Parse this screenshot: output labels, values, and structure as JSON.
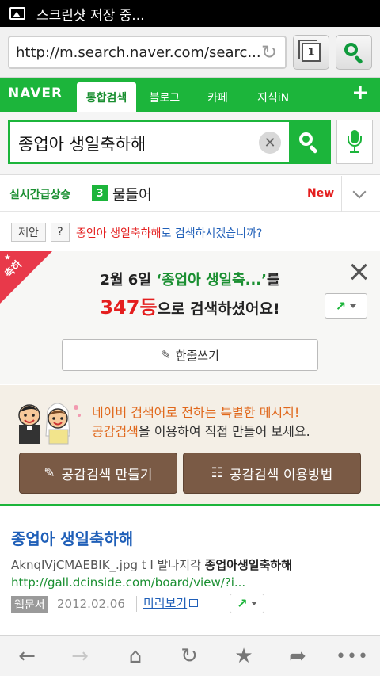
{
  "status_bar": {
    "notification": "스크린샷 저장 중..."
  },
  "browser": {
    "url": "http://m.search.naver.com/searc...",
    "tab_count": "1"
  },
  "nav": {
    "logo": "NAVER",
    "tabs": [
      {
        "label": "통합검색",
        "active": true
      },
      {
        "label": "블로그",
        "active": false
      },
      {
        "label": "카페",
        "active": false
      },
      {
        "label": "지식iN",
        "active": false
      }
    ],
    "more": "+"
  },
  "search": {
    "query": "종업아 생일축하해"
  },
  "trending": {
    "label": "실시간급상승",
    "rank": "3",
    "word": "물들어",
    "badge": "New"
  },
  "suggestion": {
    "tag_label": "제안",
    "help": "?",
    "suggested_query": "종인아 생일축하해",
    "suffix": "로 검색하시겠습니까?"
  },
  "celebration": {
    "ribbon": "축하",
    "date": "2월 6일",
    "query": "‘종업아 생일축...’",
    "line1_suffix": "를",
    "rank": "347등",
    "line2_suffix": "으로 검색하셨어요!",
    "write_button": "한줄쓰기"
  },
  "empathy": {
    "line1": "네이버 검색어로 전하는 특별한 메시지!",
    "line2_highlight": "공감검색",
    "line2_rest": "을 이용하여 직접 만들어 보세요.",
    "make_button": "공감검색 만들기",
    "howto_button": "공감검색 이용방법"
  },
  "result": {
    "title": "종업아 생일축하해",
    "snippet_plain": "AknqIVjCMAEBIK_.jpg t I 발나지각 ",
    "snippet_bold": "종업아생일축하해",
    "url": "http://gall.dcinside.com/board/view/?i...",
    "type": "웹문서",
    "date": "2012.02.06",
    "preview": "미리보기"
  },
  "colors": {
    "naver_green": "#1cb53b",
    "link_blue": "#1f5fb8",
    "alert_red": "#e41e1e",
    "empathy_orange": "#e0681c",
    "empathy_button": "#7a5a45"
  },
  "icons": {
    "status": "image-icon",
    "reload": "reload-icon",
    "search": "search-icon",
    "clear": "clear-icon",
    "voice": "microphone-icon",
    "close": "close-icon",
    "share": "share-icon",
    "pencil": "pencil-icon",
    "bottom": [
      "back-icon",
      "forward-icon",
      "home-icon",
      "refresh-icon",
      "bookmark-star-icon",
      "share-arrow-icon",
      "more-icon"
    ]
  }
}
